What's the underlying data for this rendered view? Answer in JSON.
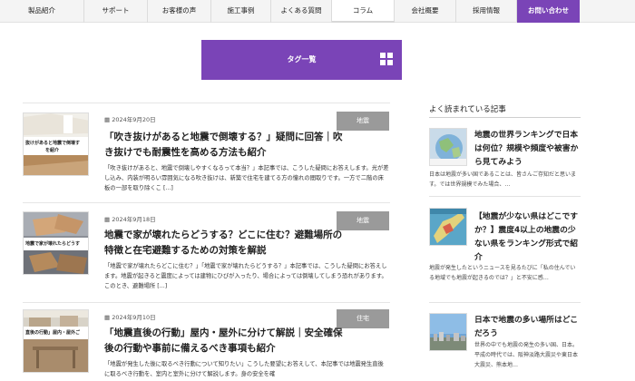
{
  "nav": {
    "items": [
      "製品紹介",
      "サポート",
      "お客様の声",
      "施工事例",
      "よくある質問",
      "コラム",
      "会社概要",
      "採用情報"
    ],
    "cta": "お問い合わせ",
    "active_index": 5,
    "accent": "#7a44b7"
  },
  "tag_banner": {
    "label": "タグ一覧",
    "icon": "grid-icon"
  },
  "articles": [
    {
      "date": "2024年9月20日",
      "category": "地震",
      "title": "「吹き抜けがあると地震で倒壊する？」疑問に回答｜吹き抜けでも耐震性を高める方法も紹介",
      "excerpt": "「吹き抜けがあると、地震で倒壊しやすくなるって本当？」本記事では、こうした疑問にお答えします。光が差し込み、内装が明るい雰囲気になる吹き抜けは、新築で住宅を建てる方の憧れの間取りです。一方で二階の床板の一部を取り除くこ [...]",
      "thumb_caption": "抜けがあると地震で倒壊す",
      "thumb_caption2": "を紹介"
    },
    {
      "date": "2024年9月18日",
      "category": "地震",
      "title": "地震で家が壊れたらどうする？どこに住む？避難場所の特徴と在宅避難するための対策を解説",
      "excerpt": "「地震で家が壊れたらどこに住む？」「地震で家が壊れたらどうする？」本記事では、こうした疑問にお答えします。地震が起きると震度によっては建物にひびが入ったり、場合によっては倒壊してしまう恐れがあります。このとき、避難場所 [...]",
      "thumb_caption": "地震で家が壊れたらどうす"
    },
    {
      "date": "2024年9月10日",
      "category": "住宅",
      "title": "「地震直後の行動」屋内・屋外に分けて解説｜安全確保後の行動や事前に備えるべき事項も紹介",
      "excerpt": "「地震が発生した後に取るべき行動について知りたい」こうした要望にお答えして、本記事では地震発生直後に取るべき行動を、室内と室外に分けて解説します。身の安全を確",
      "thumb_caption": "直後の行動」屋内・屋外ご"
    }
  ],
  "sidebar": {
    "heading": "よく読まれている記事",
    "items": [
      {
        "title": "地震の世界ランキングで日本は何位？規模や頻度や被害から見てみよう",
        "excerpt": "日本は地震が多い国であることは、皆さんご存知だと思います。では世界規模でみた場合、…"
      },
      {
        "title": "【地震が少ない県はどこですか？】震度4以上の地震の少ない県をランキング形式で紹介",
        "excerpt": "地震が発生したというニュースを見るたびに「私の住んでいる地域でも地震が起きるのでは？」と不安に感…"
      },
      {
        "title": "日本で地震の多い場所はどこだろう",
        "excerpt": "世界の中でも地震の発生の多い国、日本。平成の時代では、阪神淡路大震災や東日本大震災、熊本地…"
      }
    ]
  }
}
